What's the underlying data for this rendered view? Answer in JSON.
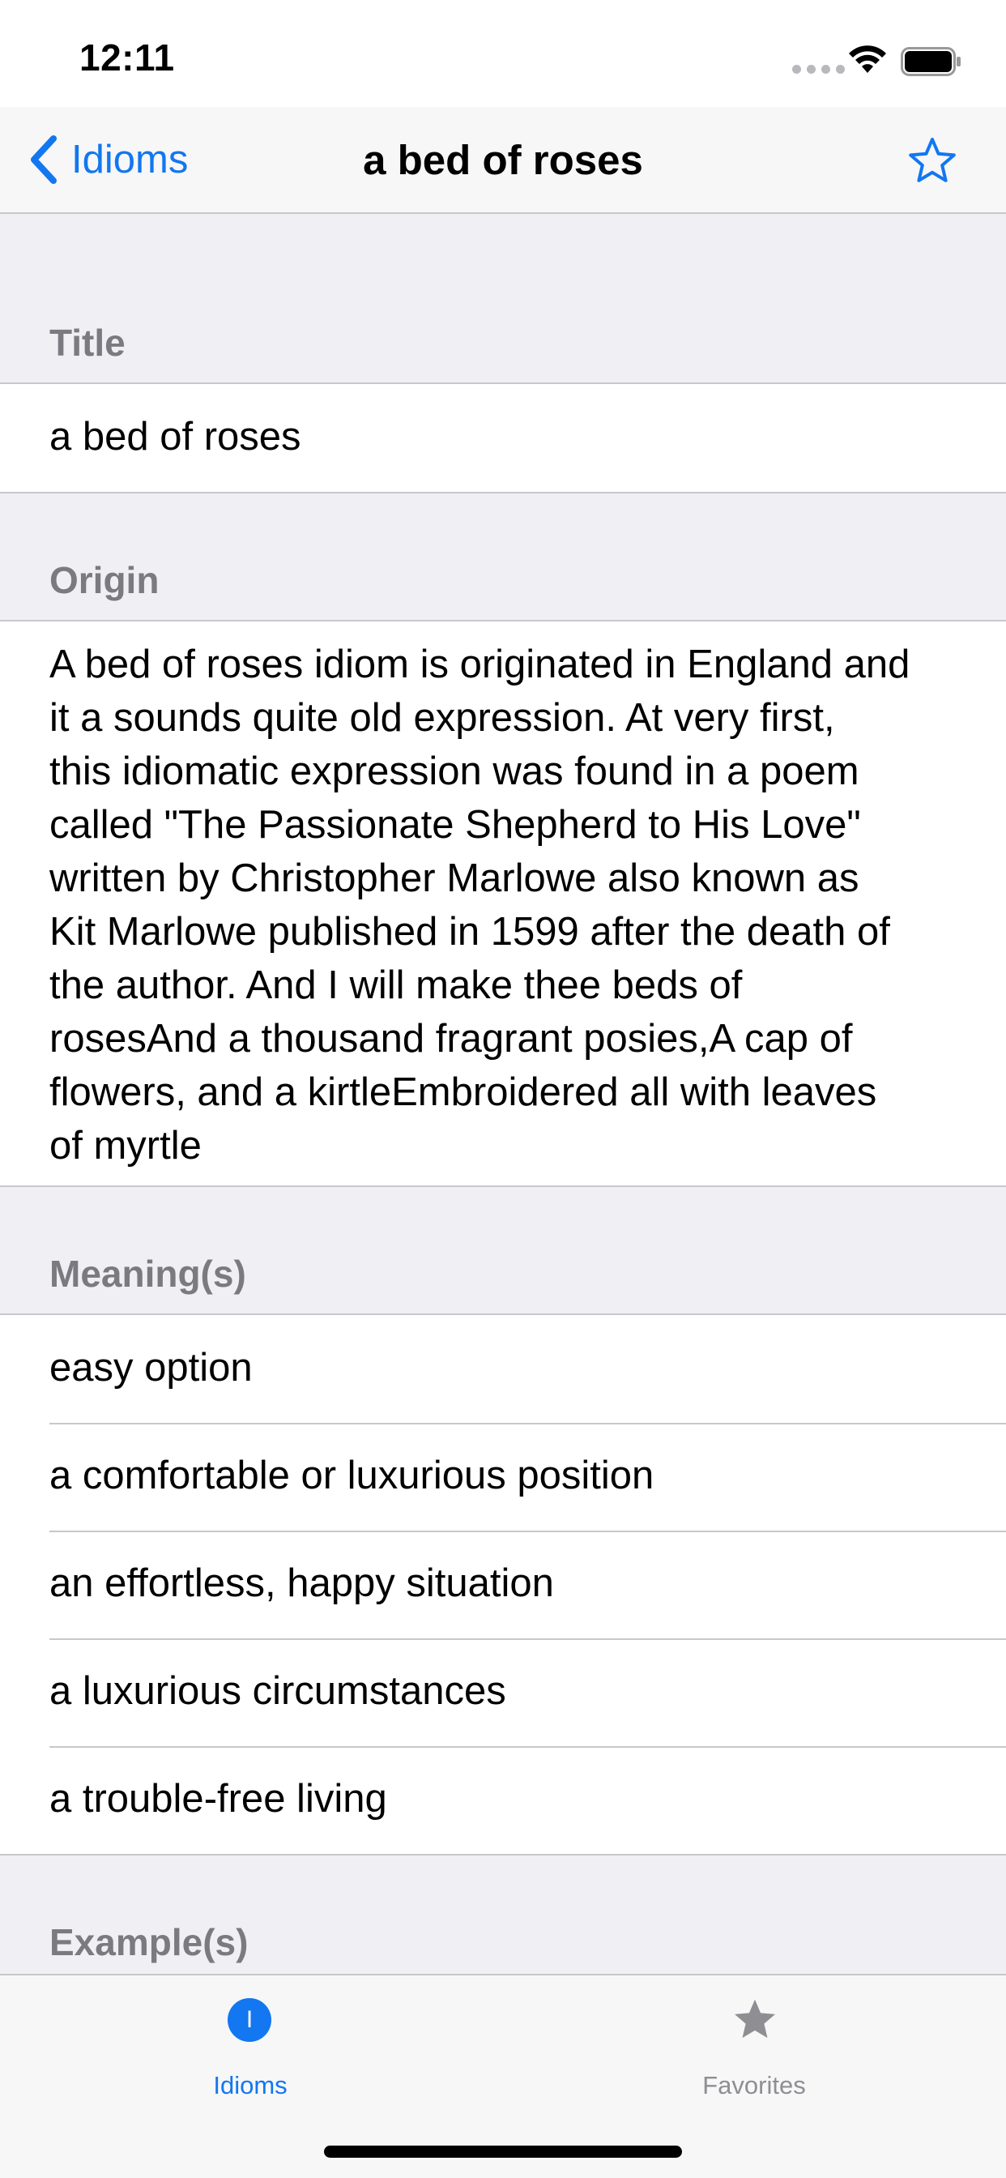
{
  "status_bar": {
    "time": "12:11"
  },
  "nav": {
    "back_label": "Idioms",
    "title": "a bed of roses"
  },
  "sections": {
    "title": {
      "header": "Title",
      "value": "a bed of roses"
    },
    "origin": {
      "header": "Origin",
      "lines": [
        "A bed of roses idiom is originated in England and",
        "it a sounds quite old expression. At very first,",
        "this idiomatic expression was found in a poem",
        "called \"The Passionate Shepherd to His Love\"",
        "written by Christopher Marlowe also known as",
        "Kit Marlowe published in 1599 after the death of",
        "the author. And I will make thee beds of",
        "rosesAnd a thousand fragrant posies,A cap of",
        "flowers, and a kirtleEmbroidered all with leaves",
        "of myrtle"
      ]
    },
    "meanings": {
      "header": "Meaning(s)",
      "items": [
        "easy option",
        "a comfortable or luxurious position",
        "an effortless, happy situation",
        "a luxurious circumstances",
        "a trouble-free living"
      ]
    },
    "examples": {
      "header": "Example(s)"
    }
  },
  "tab_bar": {
    "idioms": {
      "label": "Idioms",
      "icon_glyph": "I"
    },
    "favorites": {
      "label": "Favorites"
    }
  },
  "colors": {
    "accent": "#1277f0",
    "background": "#efeff4",
    "separator": "#c8c7cc",
    "header_text": "#7a7a80",
    "inactive_tab": "#8e8e93"
  },
  "icons": [
    "chevron-left-icon",
    "star-outline-icon",
    "wifi-icon",
    "battery-icon",
    "idioms-tab-icon",
    "star-filled-icon"
  ]
}
